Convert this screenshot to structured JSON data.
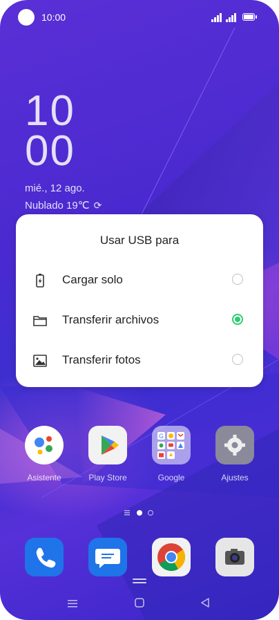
{
  "status": {
    "time": "10:00"
  },
  "lock": {
    "clock_hours": "10",
    "clock_minutes": "00",
    "date": "mié., 12 ago.",
    "weather": "Nublado 19℃"
  },
  "dialog": {
    "title": "Usar USB para",
    "options": [
      {
        "label": "Cargar solo",
        "icon": "battery-charging-icon",
        "selected": false
      },
      {
        "label": "Transferir archivos",
        "icon": "folder-icon",
        "selected": true
      },
      {
        "label": "Transferir fotos",
        "icon": "image-icon",
        "selected": false
      }
    ]
  },
  "apps": [
    {
      "label": "Asistente",
      "icon": "assistant-icon"
    },
    {
      "label": "Play Store",
      "icon": "play-store-icon"
    },
    {
      "label": "Google",
      "icon": "google-folder-icon"
    },
    {
      "label": "Ajustes",
      "icon": "settings-gear-icon"
    }
  ],
  "dock": [
    {
      "icon": "phone-icon"
    },
    {
      "icon": "messages-icon"
    },
    {
      "icon": "chrome-icon"
    },
    {
      "icon": "camera-icon"
    }
  ],
  "colors": {
    "accent_radio": "#2ecc71",
    "wallpaper": "#4a2ad0"
  }
}
